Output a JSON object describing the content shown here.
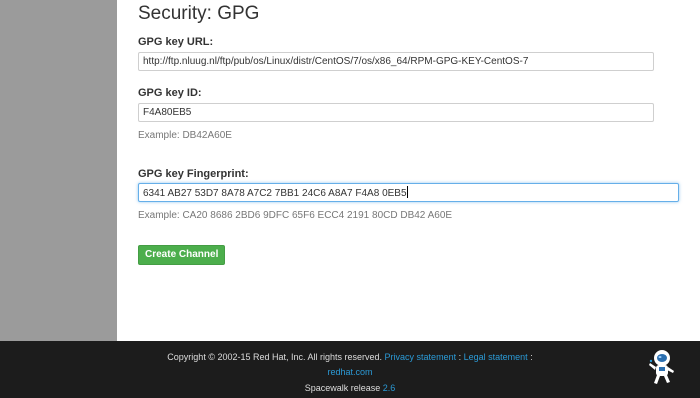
{
  "page": {
    "title": "Security: GPG"
  },
  "form": {
    "gpg_url": {
      "label": "GPG key URL:",
      "value": "http://ftp.nluug.nl/ftp/pub/os/Linux/distr/CentOS/7/os/x86_64/RPM-GPG-KEY-CentOS-7"
    },
    "gpg_id": {
      "label": "GPG key ID:",
      "value": "F4A80EB5",
      "example": "Example: DB42A60E"
    },
    "gpg_fingerprint": {
      "label": "GPG key Fingerprint:",
      "value": "6341 AB27 53D7 8A78 A7C2  7BB1 24C6 A8A7 F4A8 0EB5",
      "example": "Example: CA20 8686 2BD6 9DFC 65F6 ECC4 2191 80CD DB42 A60E"
    },
    "submit_label": "Create Channel"
  },
  "footer": {
    "copyright": "Copyright © 2002-15 Red Hat, Inc. All rights reserved.",
    "privacy_link": "Privacy statement",
    "separator": ":",
    "legal_link": "Legal statement",
    "trailing_sep": ":",
    "redhat_link": "redhat.com",
    "release_text": "Spacewalk release",
    "release_version": "2.6"
  },
  "colors": {
    "sidebar": "#9b9b9b",
    "footer_bg": "#1c1c1c",
    "button": "#4cae4c",
    "link": "#2b9ad6"
  },
  "icons": {
    "mascot": "spacewalk-astronaut-icon"
  }
}
